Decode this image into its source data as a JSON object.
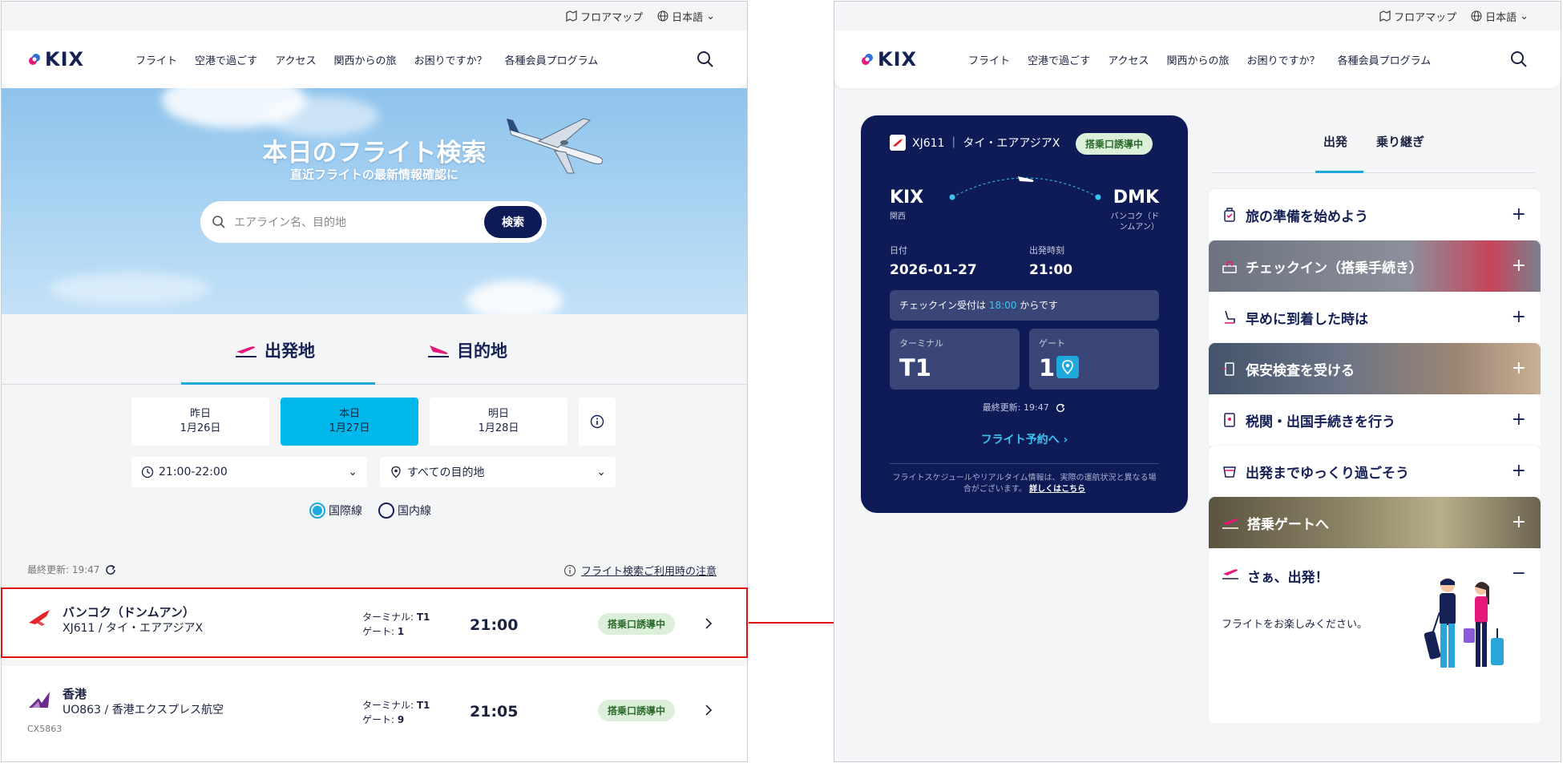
{
  "util": {
    "floor_map": "フロアマップ",
    "language": "日本語"
  },
  "header": {
    "logo": "KIX",
    "nav": [
      "フライト",
      "空港で過ごす",
      "アクセス",
      "関西からの旅",
      "お困りですか？",
      "各種会員プログラム"
    ]
  },
  "hero": {
    "title": "本日のフライト検索",
    "subtitle": "直近フライトの最新情報確認に",
    "search_placeholder": "エアライン名、目的地",
    "search_button": "検索"
  },
  "tabs": {
    "departure": "出発地",
    "arrival": "目的地"
  },
  "days": [
    {
      "label": "昨日",
      "date": "1月26日"
    },
    {
      "label": "本日",
      "date": "1月27日"
    },
    {
      "label": "明日",
      "date": "1月28日"
    }
  ],
  "filters": {
    "time": "21:00-22:00",
    "destination": "すべての目的地"
  },
  "radios": {
    "international": "国際線",
    "domestic": "国内線"
  },
  "list_meta": {
    "updated": "最終更新: 19:47",
    "notice": "フライト検索ご利用時の注意"
  },
  "flights": [
    {
      "dest": "バンコク（ドンムアン）",
      "flight": "XJ611 / タイ・エアアジアX",
      "code": "",
      "terminal_label": "ターミナル: ",
      "terminal": "T1",
      "gate_label": "ゲート: ",
      "gate": "1",
      "time": "21:00",
      "status": "搭乗口誘導中"
    },
    {
      "dest": "香港",
      "flight": "UO863 / 香港エクスプレス航空",
      "code": "CX5863",
      "terminal_label": "ターミナル: ",
      "terminal": "T1",
      "gate_label": "ゲート: ",
      "gate": "9",
      "time": "21:05",
      "status": "搭乗口誘導中"
    }
  ],
  "detail": {
    "airline": "XJ611 ｜ タイ・エアアジアX",
    "status": "搭乗口誘導中",
    "from_code": "KIX",
    "from_city": "関西",
    "to_code": "DMK",
    "to_city_1": "バンコク（ド",
    "to_city_2": "ンムアン）",
    "date_label": "日付",
    "date": "2026-01-27",
    "dep_label": "出発時刻",
    "dep_time": "21:00",
    "checkin_pre": "チェックイン受付は ",
    "checkin_time": "18:00",
    "checkin_post": " からです",
    "terminal_label": "ターミナル",
    "terminal": "T1",
    "gate_label": "ゲート",
    "gate": "1",
    "updated": "最終更新: 19:47",
    "book": "フライト予約へ ›",
    "foot": "フライトスケジュールやリアルタイム情報は、実際の運航状況と異なる場合がございます。",
    "foot_link": "詳しくはこちら"
  },
  "right_tabs": {
    "departure": "出発",
    "transfer": "乗り継ぎ"
  },
  "accordion": [
    "旅の準備を始めよう",
    "チェックイン（搭乗手続き）",
    "早めに到着した時は",
    "保安検査を受ける",
    "税関・出国手続きを行う",
    "出発までゆっくり過ごそう",
    "搭乗ゲートへ",
    "さぁ、出発！"
  ],
  "accordion_open_msg": "フライトをお楽しみください。",
  "colors": {
    "navy": "#0e1b57",
    "accent": "#00b8ec",
    "badge_bg": "#dcefd9",
    "highlight": "#e01010"
  }
}
